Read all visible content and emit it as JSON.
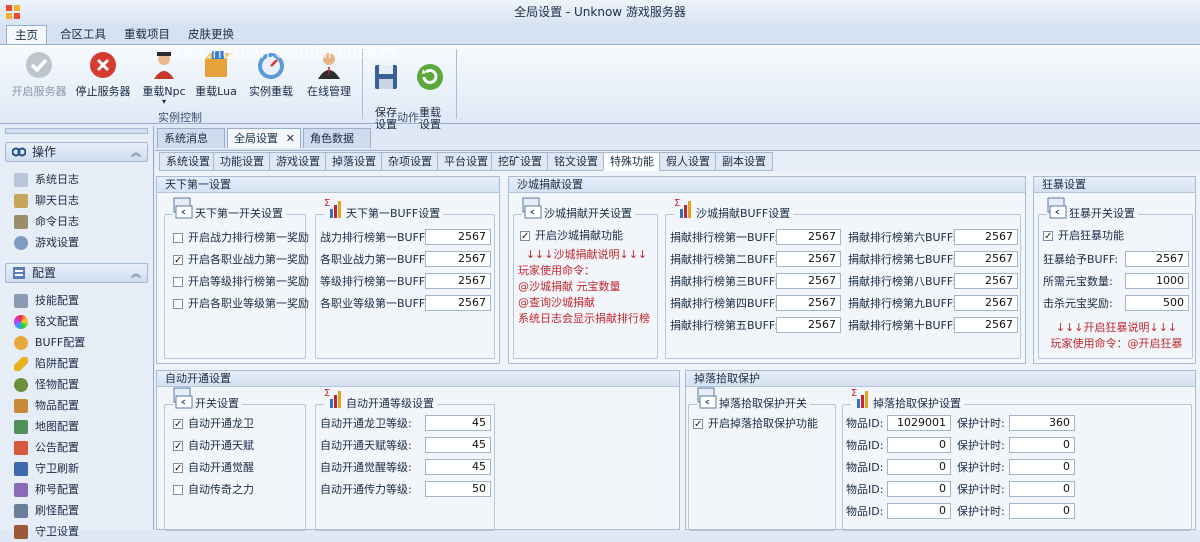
{
  "window": {
    "title": "全局设置 - Unknow 游戏服务器"
  },
  "watermark": "www.huzhan.com/ishop6425",
  "ribbon_tabs": [
    "主页",
    "合区工具",
    "重载项目",
    "皮肤更换"
  ],
  "ribbon": {
    "group1": {
      "label": "实例控制",
      "buttons": [
        "开启服务器",
        "停止服务器",
        "重载Npc",
        "重载Lua",
        "实例重载",
        "在线管理"
      ]
    },
    "group2": {
      "label": "动作",
      "buttons": [
        "保存\n设置",
        "重载\n设置"
      ]
    }
  },
  "left_panel": {
    "section1": {
      "title": "操作",
      "items": [
        "系统日志",
        "聊天日志",
        "命令日志",
        "游戏设置"
      ]
    },
    "section2": {
      "title": "配置",
      "items": [
        "技能配置",
        "铭文配置",
        "BUFF配置",
        "陷阱配置",
        "怪物配置",
        "物品配置",
        "地图配置",
        "公告配置",
        "守卫刷新",
        "称号配置",
        "刷怪配置",
        "守卫设置"
      ]
    }
  },
  "doc_tabs": [
    "系统消息",
    "全局设置",
    "角色数据"
  ],
  "sub_tabs": [
    "系统设置",
    "功能设置",
    "游戏设置",
    "掉落设置",
    "杂项设置",
    "平台设置",
    "挖矿设置",
    "铭文设置",
    "特殊功能",
    "假人设置",
    "副本设置"
  ],
  "tianxia": {
    "title": "天下第一设置",
    "switch_title": "天下第一开关设置",
    "switches": [
      {
        "label": "开启战力排行榜第一奖励",
        "checked": false
      },
      {
        "label": "开启各职业战力第一奖励",
        "checked": true
      },
      {
        "label": "开启等级排行榜第一奖励",
        "checked": false
      },
      {
        "label": "开启各职业等级第一奖励",
        "checked": false
      }
    ],
    "buff_title": "天下第一BUFF设置",
    "buffs": [
      {
        "label": "战力排行榜第一BUFF:",
        "value": "2567"
      },
      {
        "label": "各职业战力第一BUFF:",
        "value": "2567"
      },
      {
        "label": "等级排行榜第一BUFF:",
        "value": "2567"
      },
      {
        "label": "各职业等级第一BUFF:",
        "value": "2567"
      }
    ]
  },
  "shacheng": {
    "title": "沙城捐献设置",
    "switch_title": "沙城捐献开关设置",
    "switch": {
      "label": "开启沙城捐献功能",
      "checked": true
    },
    "notes": [
      "↓↓↓沙城捐献说明↓↓↓",
      "玩家使用命令：",
      "@沙城捐献 元宝数量",
      "@查询沙城捐献",
      "系统日志会显示捐献排行榜"
    ],
    "buff_title": "沙城捐献BUFF设置",
    "buffs_left": [
      {
        "label": "捐献排行榜第一BUFF:",
        "value": "2567"
      },
      {
        "label": "捐献排行榜第二BUFF:",
        "value": "2567"
      },
      {
        "label": "捐献排行榜第三BUFF:",
        "value": "2567"
      },
      {
        "label": "捐献排行榜第四BUFF:",
        "value": "2567"
      },
      {
        "label": "捐献排行榜第五BUFF:",
        "value": "2567"
      }
    ],
    "buffs_right": [
      {
        "label": "捐献排行榜第六BUFF:",
        "value": "2567"
      },
      {
        "label": "捐献排行榜第七BUFF:",
        "value": "2567"
      },
      {
        "label": "捐献排行榜第八BUFF:",
        "value": "2567"
      },
      {
        "label": "捐献排行榜第九BUFF:",
        "value": "2567"
      },
      {
        "label": "捐献排行榜第十BUFF:",
        "value": "2567"
      }
    ]
  },
  "kuangbao": {
    "title": "狂暴设置",
    "switch_title": "狂暴开关设置",
    "switch": {
      "label": "开启狂暴功能",
      "checked": true
    },
    "fields": [
      {
        "label": "狂暴给予BUFF:",
        "value": "2567"
      },
      {
        "label": "所需元宝数量:",
        "value": "1000"
      },
      {
        "label": "击杀元宝奖励:",
        "value": "500"
      }
    ],
    "notes": [
      "↓↓↓开启狂暴说明↓↓↓",
      "玩家使用命令：@开启狂暴"
    ]
  },
  "zidong": {
    "title": "自动开通设置",
    "switch_title": "开关设置",
    "switches": [
      {
        "label": "自动开通龙卫",
        "checked": true
      },
      {
        "label": "自动开通天赋",
        "checked": true
      },
      {
        "label": "自动开通觉醒",
        "checked": true
      },
      {
        "label": "自动传奇之力",
        "checked": false
      }
    ],
    "level_title": "自动开通等级设置",
    "levels": [
      {
        "label": "自动开通龙卫等级:",
        "value": "45"
      },
      {
        "label": "自动开通天赋等级:",
        "value": "45"
      },
      {
        "label": "自动开通觉醒等级:",
        "value": "45"
      },
      {
        "label": "自动开通传力等级:",
        "value": "50"
      }
    ]
  },
  "diaoluo": {
    "title": "掉落拾取保护",
    "switch_title": "掉落拾取保护开关",
    "switch": {
      "label": "开启掉落拾取保护功能",
      "checked": true
    },
    "prot_title": "掉落拾取保护设置",
    "item_label": "物品ID:",
    "timer_label": "保护计时:",
    "rows": [
      {
        "item": "1029001",
        "timer": "360"
      },
      {
        "item": "0",
        "timer": "0"
      },
      {
        "item": "0",
        "timer": "0"
      },
      {
        "item": "0",
        "timer": "0"
      },
      {
        "item": "0",
        "timer": "0"
      }
    ]
  },
  "colors": {
    "accent": "#1e6fc4",
    "note_red": "#c0282d",
    "panel_border": "#a9bcd5"
  }
}
